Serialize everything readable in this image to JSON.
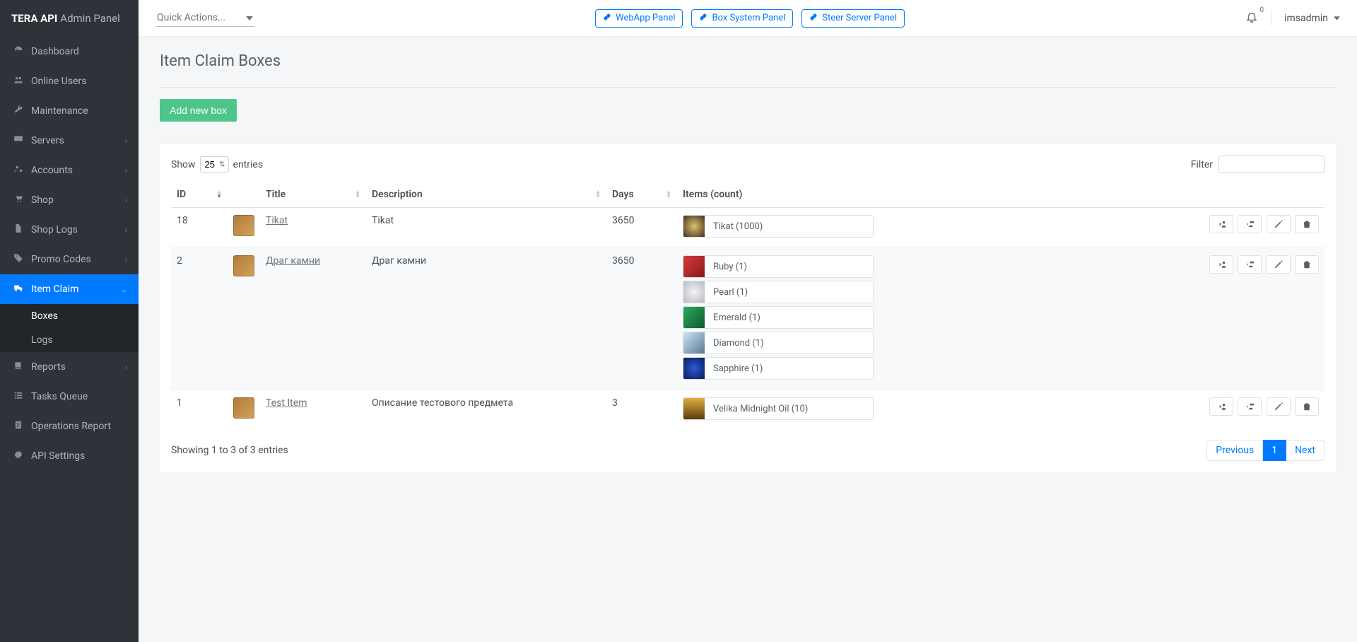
{
  "brand": {
    "bold": "TERA API",
    "rest": "Admin Panel"
  },
  "sidebar": {
    "items": [
      {
        "label": "Dashboard",
        "icon": "dashboard-icon",
        "expandable": false
      },
      {
        "label": "Online Users",
        "icon": "users-icon",
        "expandable": false
      },
      {
        "label": "Maintenance",
        "icon": "wrench-icon",
        "expandable": false
      },
      {
        "label": "Servers",
        "icon": "monitor-icon",
        "expandable": true
      },
      {
        "label": "Accounts",
        "icon": "users-cog-icon",
        "expandable": true
      },
      {
        "label": "Shop",
        "icon": "cart-icon",
        "expandable": true
      },
      {
        "label": "Shop Logs",
        "icon": "file-icon",
        "expandable": true
      },
      {
        "label": "Promo Codes",
        "icon": "tags-icon",
        "expandable": true
      },
      {
        "label": "Item Claim",
        "icon": "truck-icon",
        "expandable": true,
        "active": true,
        "children": [
          {
            "label": "Boxes",
            "active": true
          },
          {
            "label": "Logs",
            "active": false
          }
        ]
      },
      {
        "label": "Reports",
        "icon": "book-icon",
        "expandable": true
      },
      {
        "label": "Tasks Queue",
        "icon": "list-icon",
        "expandable": false
      },
      {
        "label": "Operations Report",
        "icon": "report-icon",
        "expandable": false
      },
      {
        "label": "API Settings",
        "icon": "gear-icon",
        "expandable": false
      }
    ]
  },
  "topbar": {
    "quick_actions": "Quick Actions...",
    "panels": [
      {
        "label": "WebApp Panel"
      },
      {
        "label": "Box System Panel"
      },
      {
        "label": "Steer Server Panel"
      }
    ],
    "notifications_count": "0",
    "username": "imsadmin"
  },
  "page": {
    "title": "Item Claim Boxes",
    "add_button": "Add new box"
  },
  "table": {
    "show_label": "Show",
    "entries_label": "entries",
    "page_size": "25",
    "filter_label": "Filter",
    "columns": {
      "id": "ID",
      "title": "Title",
      "description": "Description",
      "days": "Days",
      "items": "Items (count)"
    },
    "rows": [
      {
        "id": "18",
        "title": "Tikat",
        "description": "Tikat",
        "days": "3650",
        "items": [
          {
            "name": "Tikat (1000)",
            "bg": "radial-gradient(circle,#e0c070,#403020)"
          }
        ]
      },
      {
        "id": "2",
        "title": "Драг камни",
        "description": "Драг камни",
        "days": "3650",
        "items": [
          {
            "name": "Ruby (1)",
            "bg": "linear-gradient(135deg,#d43a3a,#8a1a1a)"
          },
          {
            "name": "Pearl (1)",
            "bg": "radial-gradient(circle,#f4f4f4,#b8b8c4)"
          },
          {
            "name": "Emerald (1)",
            "bg": "linear-gradient(135deg,#2faa5a,#0b5a2a)"
          },
          {
            "name": "Diamond (1)",
            "bg": "linear-gradient(135deg,#cfe3f4,#5a7a94)"
          },
          {
            "name": "Sapphire (1)",
            "bg": "radial-gradient(circle,#2a5ad4,#0a1a5a)"
          }
        ]
      },
      {
        "id": "1",
        "title": "Test Item",
        "description": "Описание тестового предмета",
        "days": "3",
        "items": [
          {
            "name": "Velika Midnight Oil (10)",
            "bg": "linear-gradient(180deg,#e0b040,#5a3a10)"
          }
        ]
      }
    ],
    "info": "Showing 1 to 3 of 3 entries",
    "pagination": {
      "previous": "Previous",
      "next": "Next",
      "current": "1"
    }
  }
}
